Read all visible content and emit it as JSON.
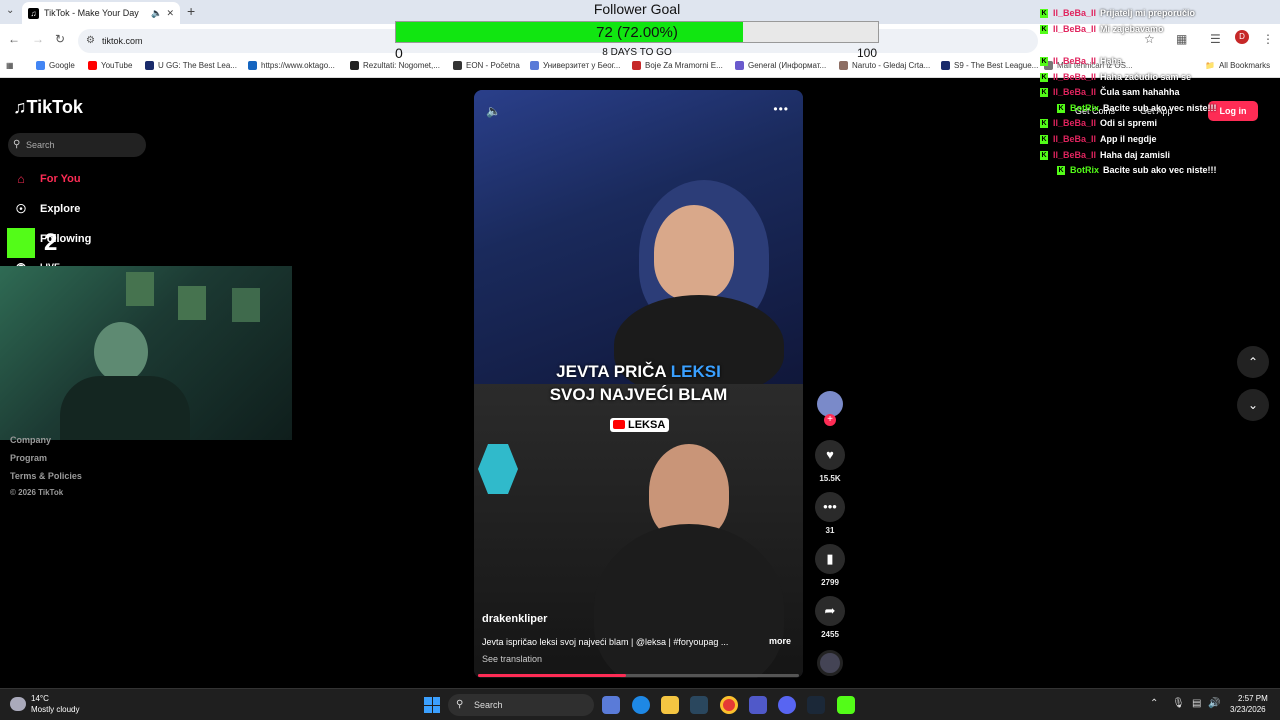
{
  "browser": {
    "tab_title": "TikTok - Make Your Day",
    "url": "tiktok.com",
    "bookmarks": [
      {
        "label": "Google",
        "color": "#4285f4"
      },
      {
        "label": "YouTube",
        "color": "#ff0000"
      },
      {
        "label": "U GG: The Best Lea...",
        "color": "#1a2b6b"
      },
      {
        "label": "https://www.oktago...",
        "color": "#1565c0"
      },
      {
        "label": "Rezultati: Nogomet,...",
        "color": "#222"
      },
      {
        "label": "EON - Početna",
        "color": "#333"
      },
      {
        "label": "Универзитет у Беог...",
        "color": "#5a7bd8"
      },
      {
        "label": "Boje Za Mramorni E...",
        "color": "#c62828"
      },
      {
        "label": "General (Информат...",
        "color": "#6a5acd"
      },
      {
        "label": "Naruto - Gledaj Crta...",
        "color": "#8d6e63"
      },
      {
        "label": "S9 - The Best League...",
        "color": "#1a2b6b"
      },
      {
        "label": "Mali tehničari iz OS...",
        "color": "#777"
      }
    ],
    "all_bookmarks": "All Bookmarks"
  },
  "goal": {
    "title": "Follower Goal",
    "value_text": "72 (72.00%)",
    "progress": 0.72,
    "min": "0",
    "max": "100",
    "days_left": "8 DAYS TO GO"
  },
  "sidebar": {
    "logo": "TikTok",
    "search_placeholder": "Search",
    "nav": {
      "for_you": "For You",
      "explore": "Explore",
      "following": "Following",
      "live": "LIVE"
    },
    "footer": [
      "Company",
      "Program",
      "Terms & Policies",
      "© 2026 TikTok"
    ],
    "kick_digit": "2"
  },
  "video": {
    "caption_line1_a": "JEVTA PRIČA ",
    "caption_line1_b": "LEKSI",
    "caption_line2": "SVOJ NAJVEĆI BLAM",
    "badge": "LEKSA",
    "author": "drakenkliper",
    "description": "Jevta ispričao leksi svoj najveći blam | @leksa | #foryoupag ...",
    "more": "more",
    "see_translation": "See translation",
    "progress": 0.46
  },
  "actions": {
    "likes": "15.5K",
    "comments": "31",
    "saves": "2799",
    "shares": "2455"
  },
  "chat": [
    {
      "user": "Il_BeBa_Il",
      "msg": "Prijatelj mi preporučio",
      "user_color": "#e0245e"
    },
    {
      "user": "Il_BeBa_Il",
      "msg": "Mi zajebavamo",
      "user_color": "#e0245e"
    },
    {
      "user": "Il_BeBa_Il",
      "msg": "Haha",
      "user_color": "#e0245e"
    },
    {
      "user": "Il_BeBa_Il",
      "msg": "Haha začudio sam se",
      "user_color": "#e0245e"
    },
    {
      "user": "Il_BeBa_Il",
      "msg": "Čula sam hahahha",
      "user_color": "#e0245e"
    },
    {
      "user": "BotRix",
      "msg": "Bacite sub ako vec niste!!!",
      "user_color": "#53fc18"
    },
    {
      "user": "Il_BeBa_Il",
      "msg": "Odi si spremi",
      "user_color": "#e0245e"
    },
    {
      "user": "Il_BeBa_Il",
      "msg": "App il negdje",
      "user_color": "#e0245e"
    },
    {
      "user": "Il_BeBa_Il",
      "msg": "Haha daj zamisli",
      "user_color": "#e0245e"
    },
    {
      "user": "BotRix",
      "msg": "Bacite sub ako vec niste!!!",
      "user_color": "#53fc18"
    }
  ],
  "tiktok_header": {
    "get_coins": "Get Coins",
    "get_app": "Get App",
    "login": "Log in"
  },
  "taskbar": {
    "temp": "14°C",
    "condition": "Mostly cloudy",
    "search": "Search",
    "time": "2:57 PM",
    "date": "3/23/2026"
  }
}
